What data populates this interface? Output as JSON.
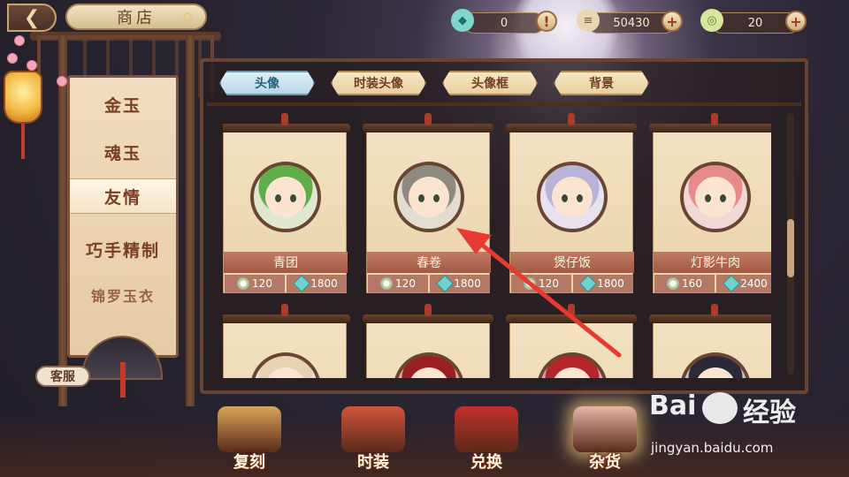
{
  "topbar": {
    "back_icon": "back-arrow-icon",
    "title": "商店",
    "home_icon": "home-icon",
    "currencies": [
      {
        "icon": "jade-gem-icon",
        "value": "0",
        "action_icon": "alert-icon",
        "action_glyph": "!"
      },
      {
        "icon": "scroll-icon",
        "value": "50430",
        "action_icon": "plus-icon",
        "action_glyph": "+"
      },
      {
        "icon": "coin-icon",
        "value": "20",
        "action_icon": "plus-icon",
        "action_glyph": "+"
      }
    ]
  },
  "left_menu": {
    "items": [
      {
        "label": "金玉",
        "active": false
      },
      {
        "label": "魂玉",
        "active": false
      },
      {
        "label": "友情",
        "active": true
      },
      {
        "label": "巧手精制",
        "active": false
      },
      {
        "label": "锦罗玉衣",
        "active": false
      }
    ],
    "service_label": "客服"
  },
  "tabs": [
    {
      "label": "头像",
      "active": true
    },
    {
      "label": "时装头像",
      "active": false
    },
    {
      "label": "头像框",
      "active": false
    },
    {
      "label": "背景",
      "active": false
    }
  ],
  "items": [
    {
      "name": "青团",
      "price_coin": "120",
      "price_gem": "1800",
      "hair": "#5fae4a",
      "bg": "#dfe8cf"
    },
    {
      "name": "春卷",
      "price_coin": "120",
      "price_gem": "1800",
      "hair": "#8f8a80",
      "bg": "#e2ddd2"
    },
    {
      "name": "煲仔饭",
      "price_coin": "120",
      "price_gem": "1800",
      "hair": "#b8b4d8",
      "bg": "#e8e2ee"
    },
    {
      "name": "灯影牛肉",
      "price_coin": "160",
      "price_gem": "2400",
      "hair": "#e8898a",
      "bg": "#f0d8d6"
    },
    {
      "name": "",
      "hair": "#e9d2b4",
      "bg": "#f0e4d0"
    },
    {
      "name": "",
      "hair": "#9a1f24",
      "bg": "#d9a8a0"
    },
    {
      "name": "",
      "hair": "#b4262a",
      "bg": "#d9a8a0"
    },
    {
      "name": "",
      "hair": "#2a2a38",
      "bg": "#c8c0c8"
    }
  ],
  "bottom_nav": [
    {
      "label": "复刻",
      "active": false,
      "color": "#d9a45a"
    },
    {
      "label": "时装",
      "active": false,
      "color": "#d2543e"
    },
    {
      "label": "兑换",
      "active": false,
      "color": "#c2302a"
    },
    {
      "label": "杂货",
      "active": true,
      "color": "#e9b6a6"
    }
  ],
  "watermark": {
    "logo": "Bai",
    "logo2": "经验",
    "url": "jingyan.baidu.com"
  },
  "colors": {
    "arrow": "#e83a30",
    "accent": "#caa56a",
    "panel": "#6a4432"
  }
}
